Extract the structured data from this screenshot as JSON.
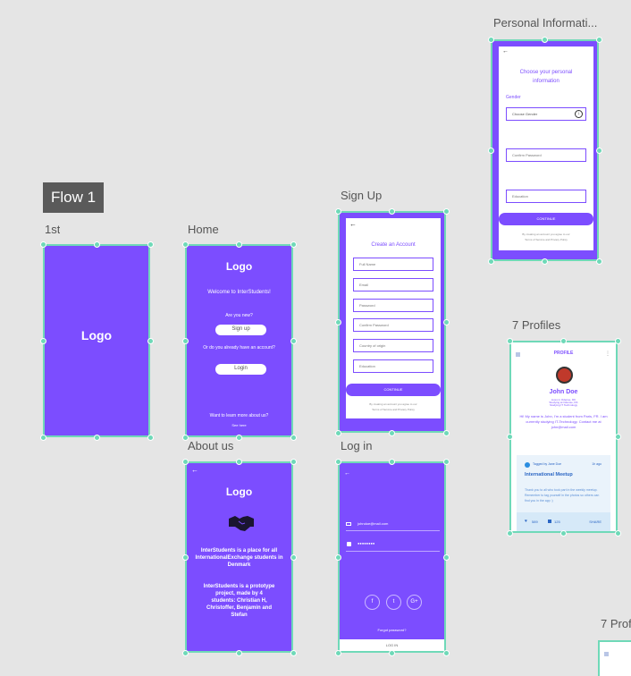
{
  "flow_label": "Flow 1",
  "artboards": {
    "first": {
      "label": "1st",
      "logo": "Logo"
    },
    "home": {
      "label": "Home",
      "logo": "Logo",
      "welcome": "Welcome to InterStudents!",
      "are_you_new": "Are you new?",
      "signup_button": "Sign up",
      "already_account": "Or do you already have an account?",
      "login_button": "Login",
      "want_learn": "Want to learn more about us?",
      "see_here": "See here"
    },
    "about": {
      "label": "About us",
      "back": "←",
      "logo": "Logo",
      "para1": "InterStudents is a place for all InternationalExchange students in Denmark",
      "para2": "InterStudents is a prototype project, made by 4 students: Christian H, Christoffer, Benjamin and Stefan"
    },
    "signup": {
      "label": "Sign Up",
      "back": "←",
      "title": "Create an Account",
      "fields": [
        "Full Name",
        "Email",
        "Password",
        "Confirm Password",
        "Country of origin",
        "Education"
      ],
      "continue": "CONTINUE",
      "terms1": "By creating an account you agree to our",
      "terms2": "Terms of Service and Privacy Policy"
    },
    "login": {
      "label": "Log in",
      "back": "←",
      "email": "johndoe@mail.com",
      "password": "●●●●●●●●",
      "forgot": "Forgot password?",
      "social": [
        "f",
        "t",
        "G+"
      ],
      "footer": "LOG IN"
    },
    "personal": {
      "label": "Personal Informati...",
      "back": "←",
      "title": "Choose your personal information",
      "gender_label": "Gender",
      "gender_placeholder": "Choose Gender",
      "confirm_password": "Confirm Password",
      "education": "Education",
      "continue": "CONTINUE",
      "terms1": "By creating an account you agree to our",
      "terms2": "Terms of Service and Privacy Policy"
    },
    "profiles": {
      "label": "7 Profiles",
      "header": "PROFILE",
      "name": "John Doe",
      "info1": "Lives in Odense, DK",
      "info2": "Studying at Odense, DK",
      "info3": "Studying IT Technology",
      "bio": "Hi! My name is John, I'm a student from Paris, FR. I am currently studying IT-Technology. Contact me at john@mail.com",
      "tagged": "Tagged by Jane Doe",
      "ago": "1h ago",
      "event_title": "International Meetup",
      "event_text": "Thank you to all who took part in the weekly meetup. Remember to tag yourself in the photos so others can find you in the app :)",
      "likes": "589",
      "comments": "125",
      "share": "SHARE"
    },
    "profiles2": {
      "label": "7 Prof"
    }
  },
  "colors": {
    "purple": "#7c4dff",
    "teal": "#6fd9b8",
    "canvas": "#e5e5e5",
    "flow_tag": "#5a5a5a"
  }
}
